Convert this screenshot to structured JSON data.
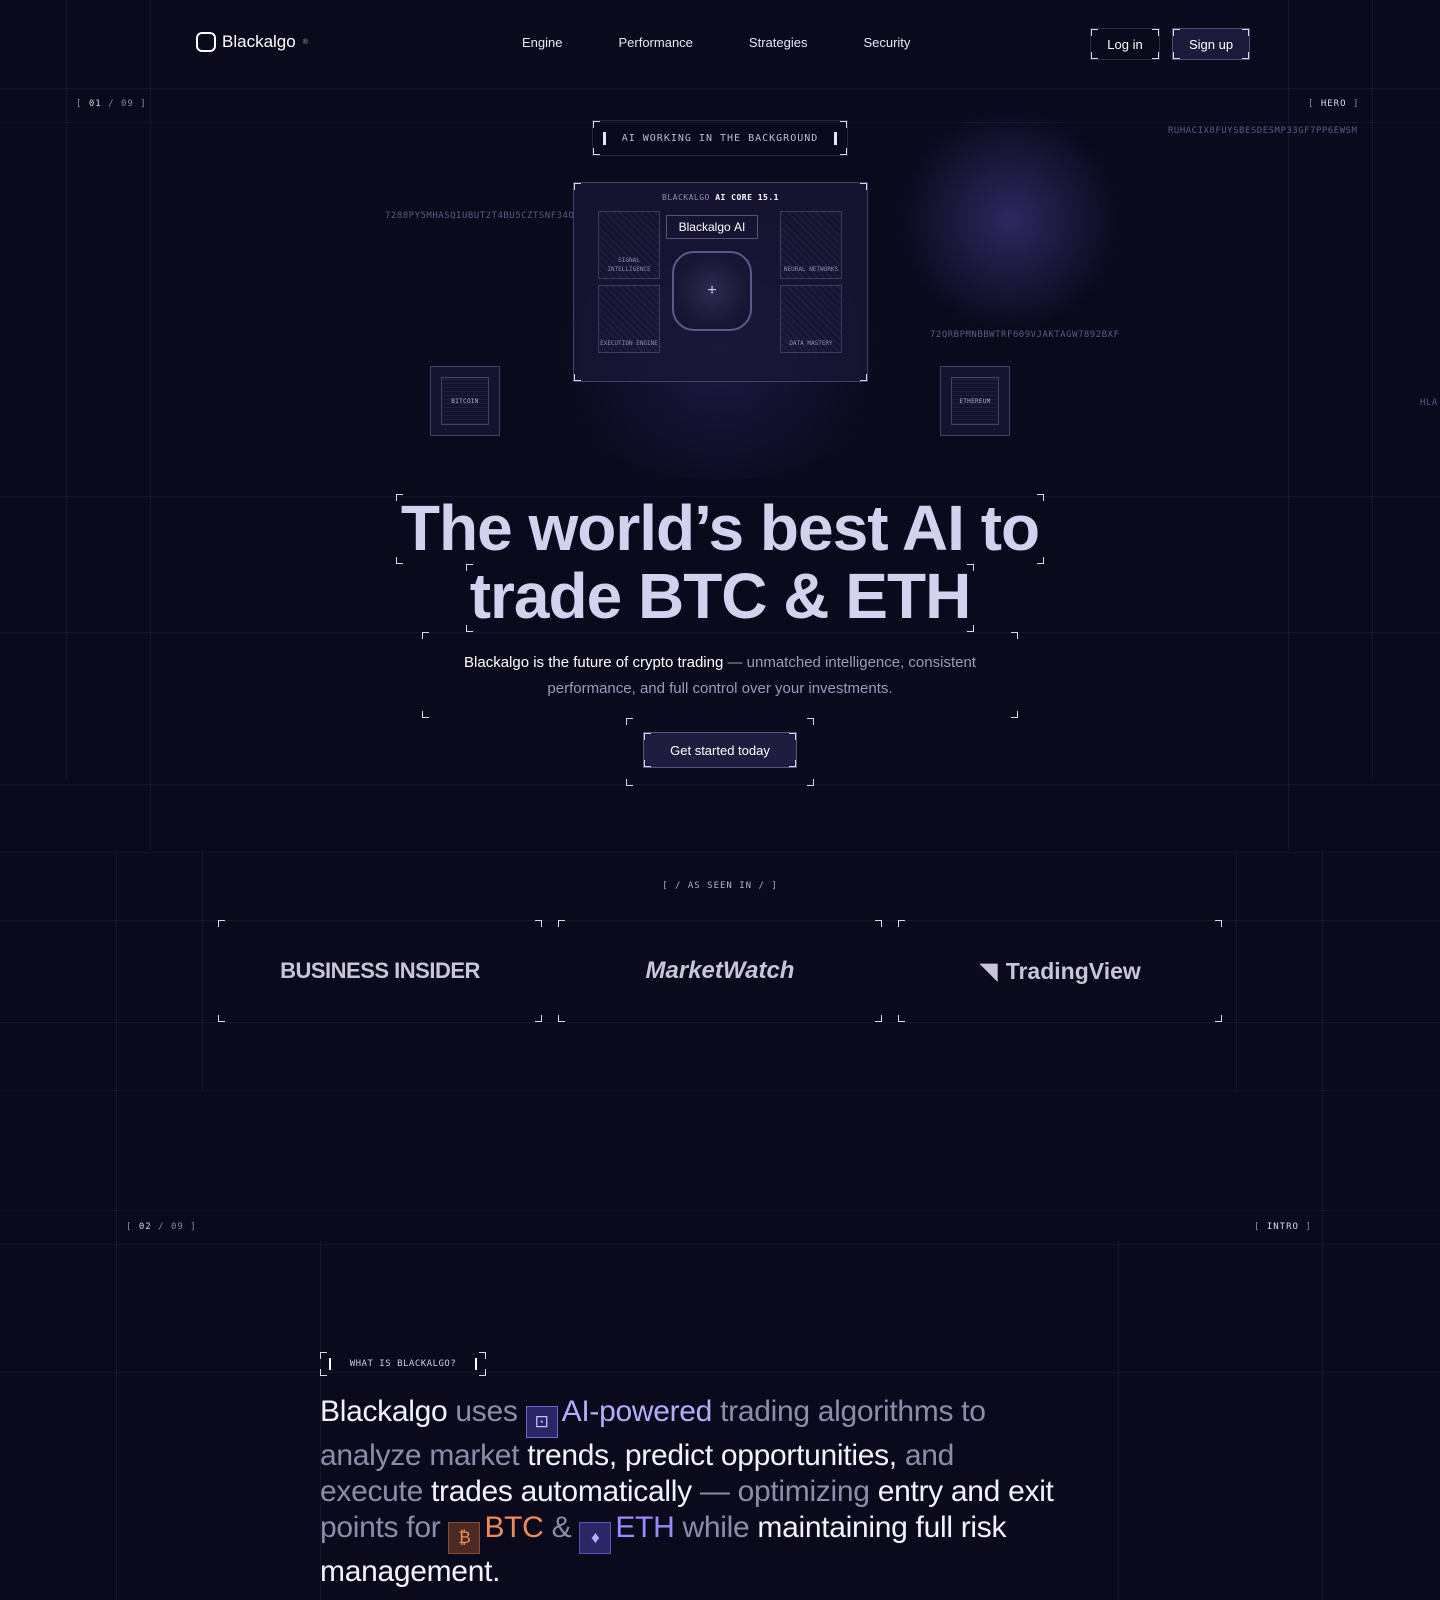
{
  "nav": {
    "brand": "Blackalgo",
    "brand_mark": "®",
    "links": [
      "Engine",
      "Performance",
      "Strategies",
      "Security"
    ],
    "login": "Log in",
    "signup": "Sign up"
  },
  "hero": {
    "section_index": "01",
    "section_total": "09",
    "section_tag": "HERO",
    "pill": "AI WORKING IN THE BACKGROUND",
    "code_right": "RUHACIX8FUYSBESDESMP33GF7PP6EWSM",
    "code_left": "7288PY5MHASQIUBUT2T4BU5CZTSNF34O",
    "code_mid": "72QRBPMNBBWTRF609VJAKTAGW7892BXF",
    "code_edge": "HLA",
    "core": {
      "title_prefix": "BLACKALGO",
      "title_mid": "AI CORE",
      "title_version": "15.1",
      "brand": "Blackalgo",
      "brand_suffix": "AI",
      "cells": [
        "SIGNAL INTELLIGENCE",
        "NEURAL NETWORKS",
        "EXECUTION ENGINE",
        "DATA MASTERY"
      ]
    },
    "nodes": [
      "BITCOIN",
      "ETHEREUM"
    ],
    "headline_1": "The world’s best AI to",
    "headline_2": "trade BTC & ETH",
    "sub_strong": "Blackalgo is the future of crypto trading",
    "sub_rest": " — unmatched intelligence, consistent performance, and full control over your investments.",
    "cta": "Get started today"
  },
  "seen_in": {
    "label": "[ / AS SEEN IN / ]",
    "brands": [
      "BUSINESS INSIDER",
      "MarketWatch",
      "TradingView"
    ]
  },
  "intro": {
    "section_index": "02",
    "section_total": "09",
    "section_tag": "INTRO",
    "pill": "WHAT IS BLACKALGO?",
    "p": {
      "t1": "Blackalgo",
      "t2": " uses ",
      "t3": "AI-powered",
      "t4": " trading algorithms to analyze market ",
      "t5": "trends, predict opportunities,",
      "t6": " and execute ",
      "t7": "trades automatically",
      "t8": " — optimizing ",
      "t9": "entry and exit",
      "t10": " points for ",
      "t11": "BTC",
      "t12": " & ",
      "t13": "ETH",
      "t14": " while ",
      "t15": "maintaining full risk management."
    }
  },
  "colors": {
    "background": "#0b0a1d",
    "accent": "#b3acff",
    "btc": "#ee8b5a",
    "eth": "#9a8cff"
  }
}
